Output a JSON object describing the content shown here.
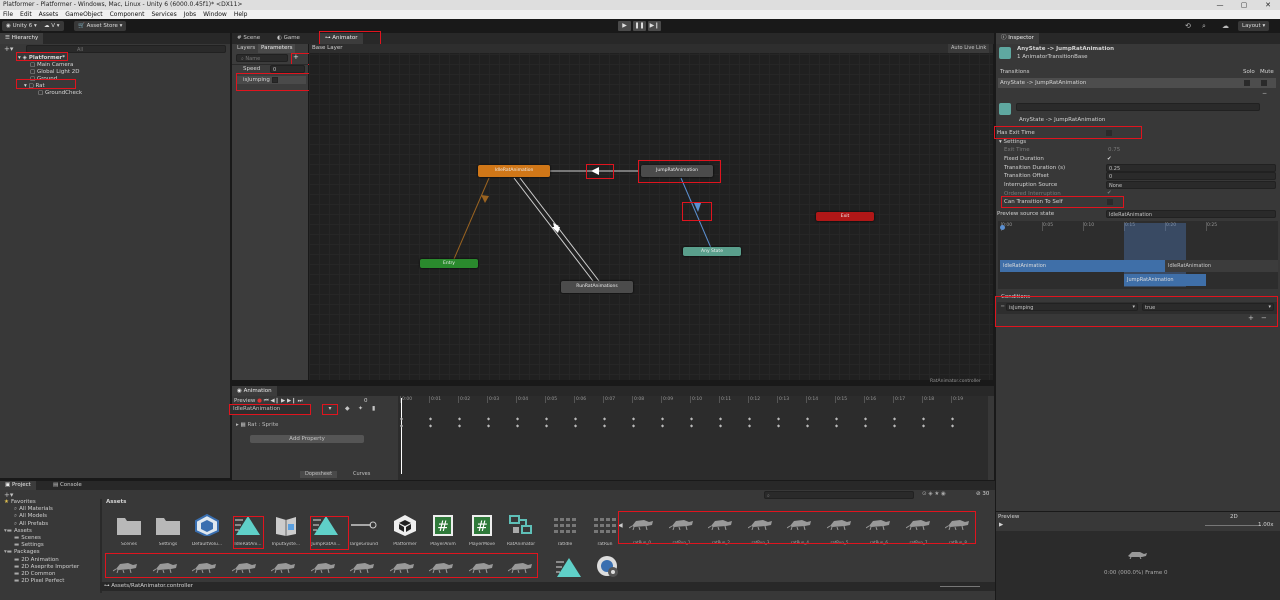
{
  "window": {
    "title": "Platformer - Platformer - Windows, Mac, Linux - Unity 6 (6000.0.45f1)* <DX11>",
    "controls": [
      "—",
      "▢",
      "✕"
    ]
  },
  "menu": [
    "File",
    "Edit",
    "Assets",
    "GameObject",
    "Component",
    "Services",
    "Jobs",
    "Window",
    "Help"
  ],
  "toolbar": {
    "account": "Unity 6",
    "cloud": "V",
    "asset_store": "Asset Store",
    "layout": "Layout"
  },
  "hierarchy": {
    "tab": "Hierarchy",
    "search_placeholder": "All",
    "items": [
      {
        "label": "Platformer*",
        "level": 0
      },
      {
        "label": "Main Camera",
        "level": 1
      },
      {
        "label": "Global Light 2D",
        "level": 1
      },
      {
        "label": "Ground",
        "level": 1
      },
      {
        "label": "Rat",
        "level": 1
      },
      {
        "label": "GroundCheck",
        "level": 2
      }
    ]
  },
  "scene_tabs": [
    "Scene",
    "Game",
    "Animator"
  ],
  "animator": {
    "layers_tab": "Layers",
    "parameters_tab": "Parameters",
    "base_layer": "Base Layer",
    "auto_live_link": "Auto Live Link",
    "search_placeholder": "Name",
    "add_button": "+",
    "parameters": [
      {
        "name": "Speed",
        "value": "0"
      },
      {
        "name": "isJumping",
        "value": ""
      }
    ],
    "states": {
      "idle": "IdleRatAnimation",
      "jump": "JumpRatAnimation",
      "entry": "Entry",
      "any_state": "Any State",
      "run": "RunRatAnimations",
      "exit": "Exit"
    },
    "footer": "RatAnimator.controller"
  },
  "animation": {
    "tab": "Animation",
    "preview": "Preview",
    "frame": "0",
    "clip": "IdleRatAnimation",
    "track": "Rat : Sprite",
    "add_property": "Add Property",
    "dopesheet": "Dopesheet",
    "curves": "Curves",
    "ticks": [
      "0:00",
      "0:01",
      "0:02",
      "0:03",
      "0:04",
      "0:05",
      "0:06",
      "0:07",
      "0:08",
      "0:09",
      "0:10",
      "0:11",
      "0:12",
      "0:13",
      "0:14",
      "0:15",
      "0:16",
      "0:17",
      "0:18",
      "0:19"
    ]
  },
  "inspector": {
    "tab": "Inspector",
    "title": "AnyState -> JumpRatAnimation",
    "subtitle": "1 AnimatorTransitionBase",
    "transitions_header": "Transitions",
    "solo": "Solo",
    "mute": "Mute",
    "transition_row": "AnyState -> JumpRatAnimation",
    "transition_label": "AnyState -> JumpRatAnimation",
    "has_exit_time": "Has Exit Time",
    "settings": "Settings",
    "fields": [
      {
        "label": "Exit Time",
        "value": "0.75",
        "disabled": true
      },
      {
        "label": "Fixed Duration",
        "value": "✔",
        "disabled": false
      },
      {
        "label": "Transition Duration (s)",
        "value": "0.25",
        "disabled": false
      },
      {
        "label": "Transition Offset",
        "value": "0",
        "disabled": false
      },
      {
        "label": "Interruption Source",
        "value": "None",
        "disabled": false
      },
      {
        "label": "Ordered Interruption",
        "value": "✔",
        "disabled": true
      }
    ],
    "can_transition_to_self": "Can Transition To Self",
    "preview_source_label": "Preview source state",
    "preview_source_value": "IdleRatAnimation",
    "timeline_ticks": [
      "0:00",
      "0:05",
      "0:10",
      "0:15",
      "0:20",
      "0:25"
    ],
    "bar_idle_1": "IdleRatAnimation",
    "bar_idle_2": "IdleRatAnimation",
    "bar_jump": "JumpRatAnimation",
    "conditions_header": "Conditions",
    "condition_param": "isJumping",
    "condition_value": "true",
    "preview_header": "Preview",
    "preview_speed": "2D",
    "preview_rate": "1.00x",
    "preview_status": "0:00 (000.0%) Frame 0"
  },
  "project": {
    "tabs": [
      "Project",
      "Console"
    ],
    "tree": [
      {
        "label": "Favorites",
        "level": 0
      },
      {
        "label": "All Materials",
        "level": 1
      },
      {
        "label": "All Models",
        "level": 1
      },
      {
        "label": "All Prefabs",
        "level": 1
      },
      {
        "label": "Assets",
        "level": 0
      },
      {
        "label": "Scenes",
        "level": 1
      },
      {
        "label": "Settings",
        "level": 1
      },
      {
        "label": "Packages",
        "level": 0
      },
      {
        "label": "2D Animation",
        "level": 1
      },
      {
        "label": "2D Aseprite Importer",
        "level": 1
      },
      {
        "label": "2D Common",
        "level": 1
      },
      {
        "label": "2D Pixel Perfect",
        "level": 1
      }
    ],
    "breadcrumb": "Assets",
    "count": "30",
    "footer_path": "Assets/RatAnimator.controller",
    "assets": [
      {
        "label": "Scenes",
        "icon": "folder-icon"
      },
      {
        "label": "Settings",
        "icon": "folder-icon"
      },
      {
        "label": "DefaultVolu...",
        "icon": "volume-profile-icon"
      },
      {
        "label": "IdleRatAni...",
        "icon": "animation-clip-icon"
      },
      {
        "label": "InputSyste...",
        "icon": "input-actions-icon"
      },
      {
        "label": "JumpRatAn...",
        "icon": "animation-clip-icon"
      },
      {
        "label": "largeGround",
        "icon": "prefab-link-icon"
      },
      {
        "label": "Platformer",
        "icon": "unity-scene-icon"
      },
      {
        "label": "PlayerAnim",
        "icon": "csharp-script-icon"
      },
      {
        "label": "PlayerMove",
        "icon": "csharp-script-icon"
      },
      {
        "label": "RatAnimator",
        "icon": "animator-controller-icon"
      },
      {
        "label": "ratIdle",
        "icon": "sprite-sheet-icon"
      },
      {
        "label": "ratRun",
        "icon": "sprite-sheet-icon"
      }
    ],
    "run_sprites": [
      "ratRun_0",
      "ratRun_1",
      "ratRun_2",
      "ratRun_3",
      "ratRun_4",
      "ratRun_5",
      "ratRun_6",
      "ratRun_7",
      "ratRun_8"
    ]
  }
}
